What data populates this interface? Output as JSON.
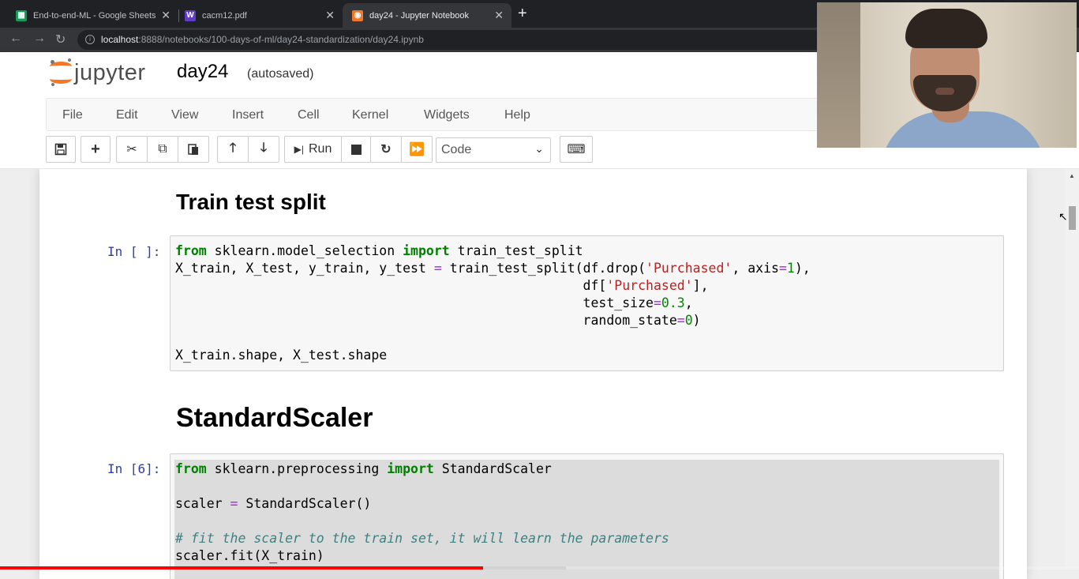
{
  "browser": {
    "tabs": [
      {
        "title": "End-to-end-ML - Google Sheets",
        "icon": "sheets-icon",
        "color": "#0f9d58",
        "active": false
      },
      {
        "title": "cacm12.pdf",
        "icon": "pdf-w-icon",
        "color": "#5f3dc4",
        "active": false
      },
      {
        "title": "day24 - Jupyter Notebook",
        "icon": "jupyter-icon",
        "color": "#f37726",
        "active": true
      }
    ],
    "url_host": "localhost",
    "url_path": ":8888/notebooks/100-days-of-ml/day24-standardization/day24.ipynb"
  },
  "jupyter": {
    "logo_text": "jupyter",
    "notebook_name": "day24",
    "save_status": "(autosaved)",
    "menu": [
      "File",
      "Edit",
      "View",
      "Insert",
      "Cell",
      "Kernel",
      "Widgets",
      "Help"
    ],
    "run_label": "Run",
    "cell_type": "Code"
  },
  "cells": {
    "heading1": "Train test split",
    "prompt1": "In [ ]:",
    "heading2": "StandardScaler",
    "prompt2": "In [6]:"
  },
  "video": {
    "progress_fraction": 0.448
  }
}
